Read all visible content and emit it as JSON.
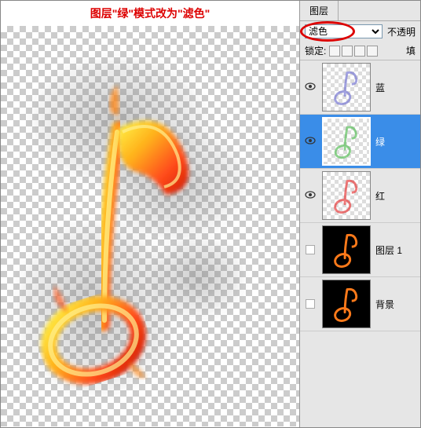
{
  "instruction": "图层\"绿\"模式改为\"滤色\"",
  "panel": {
    "tab": "图层",
    "blend_mode": "滤色",
    "opacity_label": "不透明",
    "lock_label": "锁定:",
    "fill_label": "填"
  },
  "layers": [
    {
      "name": "蓝",
      "visible": true,
      "selected": false,
      "bg": "chk",
      "tint": "#7a7ad4"
    },
    {
      "name": "绿",
      "visible": true,
      "selected": true,
      "bg": "chk",
      "tint": "#5cc05c"
    },
    {
      "name": "红",
      "visible": true,
      "selected": false,
      "bg": "chk",
      "tint": "#e84040"
    },
    {
      "name": "图层 1",
      "visible": false,
      "selected": false,
      "bg": "black",
      "tint": "#ff7a1a"
    },
    {
      "name": "背景",
      "visible": false,
      "selected": false,
      "bg": "black",
      "tint": "#ff7a1a"
    }
  ]
}
